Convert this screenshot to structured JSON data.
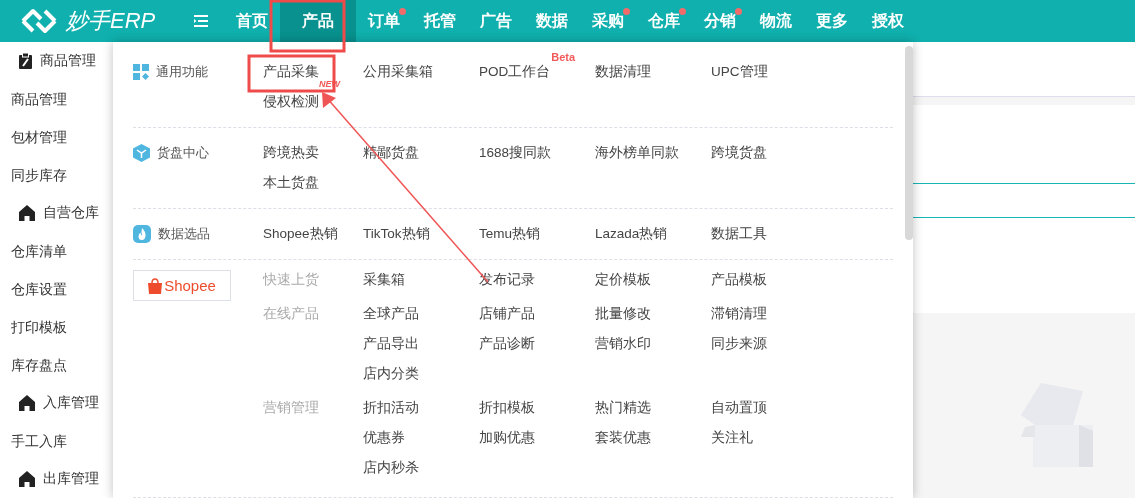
{
  "topbar": {
    "logo": "妙手ERP",
    "nav": [
      {
        "label": "首页",
        "selected": false,
        "dot": false
      },
      {
        "label": "产品",
        "selected": true,
        "dot": false
      },
      {
        "label": "订单",
        "selected": false,
        "dot": true
      },
      {
        "label": "托管",
        "selected": false,
        "dot": false
      },
      {
        "label": "广告",
        "selected": false,
        "dot": false
      },
      {
        "label": "数据",
        "selected": false,
        "dot": false
      },
      {
        "label": "采购",
        "selected": false,
        "dot": true
      },
      {
        "label": "仓库",
        "selected": false,
        "dot": true
      },
      {
        "label": "分销",
        "selected": false,
        "dot": true
      },
      {
        "label": "物流",
        "selected": false,
        "dot": false
      },
      {
        "label": "更多",
        "selected": false,
        "dot": false
      },
      {
        "label": "授权",
        "selected": false,
        "dot": false
      }
    ]
  },
  "sidebar": {
    "items": [
      {
        "label": "商品管理",
        "kind": "clipboard-heading"
      },
      {
        "label": "商品管理",
        "kind": "link"
      },
      {
        "label": "包材管理",
        "kind": "link"
      },
      {
        "label": "同步库存",
        "kind": "link"
      },
      {
        "label": "自营仓库",
        "kind": "house-heading"
      },
      {
        "label": "仓库清单",
        "kind": "link"
      },
      {
        "label": "仓库设置",
        "kind": "link"
      },
      {
        "label": "打印模板",
        "kind": "link"
      },
      {
        "label": "库存盘点",
        "kind": "link"
      },
      {
        "label": "入库管理",
        "kind": "house-heading"
      },
      {
        "label": "手工入库",
        "kind": "link"
      },
      {
        "label": "出库管理",
        "kind": "house-heading"
      }
    ]
  },
  "menu": {
    "sections": [
      {
        "kind": "grid",
        "title": "通用功能",
        "items": [
          {
            "label": "产品采集",
            "badge": "NEW"
          },
          {
            "label": "公用采集箱"
          },
          {
            "label": "POD工作台",
            "badge": "Beta"
          },
          {
            "label": "数据清理"
          },
          {
            "label": "UPC管理"
          },
          {
            "label": "侵权检测"
          }
        ]
      },
      {
        "kind": "cube",
        "title": "货盘中心",
        "items": [
          {
            "label": "跨境热卖"
          },
          {
            "label": "精鄙货盘"
          },
          {
            "label": "1688搜同款"
          },
          {
            "label": "海外榜单同款"
          },
          {
            "label": "跨境货盘"
          },
          {
            "label": "本土货盘"
          }
        ]
      },
      {
        "kind": "flame",
        "title": "数据选品",
        "items": [
          {
            "label": "Shopee热销"
          },
          {
            "label": "TikTok热销"
          },
          {
            "label": "Temu热销"
          },
          {
            "label": "Lazada热销"
          },
          {
            "label": "数据工具"
          }
        ]
      },
      {
        "kind": "shopee",
        "title": "Shopee",
        "groups": [
          {
            "label": "快速上货",
            "items": [
              "采集箱",
              "发布记录",
              "定价模板",
              "产品模板"
            ]
          },
          {
            "label": "在线产品",
            "items": [
              "全球产品",
              "店铺产品",
              "批量修改",
              "滞销清理",
              "产品导出",
              "产品诊断",
              "营销水印",
              "同步来源",
              "店内分类"
            ]
          },
          {
            "label": "营销管理",
            "items": [
              "折扣活动",
              "折扣模板",
              "热门精选",
              "自动置顶",
              "优惠券",
              "加购优惠",
              "套装优惠",
              "关注礼",
              "店内秒杀"
            ]
          }
        ]
      }
    ]
  }
}
